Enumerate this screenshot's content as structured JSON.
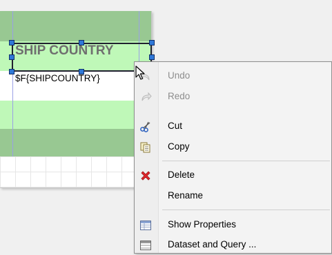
{
  "designer": {
    "header_text": "SHIP COUNTRY",
    "field_expression": "$F{SHIPCOUNTRY}"
  },
  "context_menu": {
    "items": [
      {
        "label": "Undo",
        "icon": "undo-icon",
        "enabled": false
      },
      {
        "label": "Redo",
        "icon": "redo-icon",
        "enabled": false
      },
      {
        "label": "Cut",
        "icon": "scissors-icon",
        "enabled": true
      },
      {
        "label": "Copy",
        "icon": "copy-icon",
        "enabled": true
      },
      {
        "label": "Delete",
        "icon": "delete-x-icon",
        "enabled": true
      },
      {
        "label": "Rename",
        "icon": "",
        "enabled": true
      },
      {
        "label": "Show Properties",
        "icon": "properties-icon",
        "enabled": true
      },
      {
        "label": "Dataset and Query ...",
        "icon": "dataset-icon",
        "enabled": true
      }
    ]
  },
  "colors": {
    "title_band": "#98c892",
    "header_band": "#bff8b8",
    "selection_handle": "#2f78d8",
    "delete_icon": "#e0282c"
  }
}
